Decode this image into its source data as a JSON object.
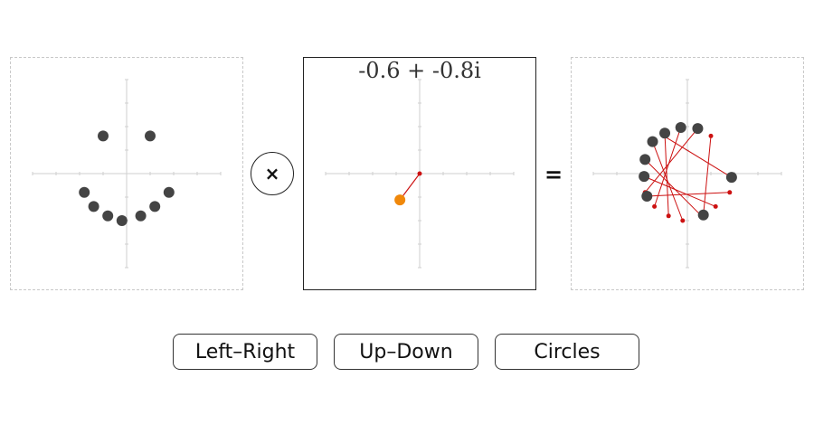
{
  "multiplier": {
    "label": "-0.6 + -0.8i",
    "re": -0.6,
    "im": -0.8
  },
  "operators": {
    "times": "×",
    "equals": "="
  },
  "buttons": {
    "left_right": "Left–Right",
    "up_down": "Up–Down",
    "circles": "Circles"
  },
  "colors": {
    "dot": "#444444",
    "multiplier_dot": "#f0880a",
    "line": "#cc1111",
    "axis": "#cfcfcf"
  },
  "points": [
    [
      -0.5,
      0.8
    ],
    [
      0.5,
      0.8
    ],
    [
      -0.9,
      -0.4
    ],
    [
      -0.7,
      -0.7
    ],
    [
      -0.4,
      -0.9
    ],
    [
      -0.1,
      -1.0
    ],
    [
      0.3,
      -0.9
    ],
    [
      0.6,
      -0.7
    ],
    [
      0.9,
      -0.4
    ]
  ]
}
